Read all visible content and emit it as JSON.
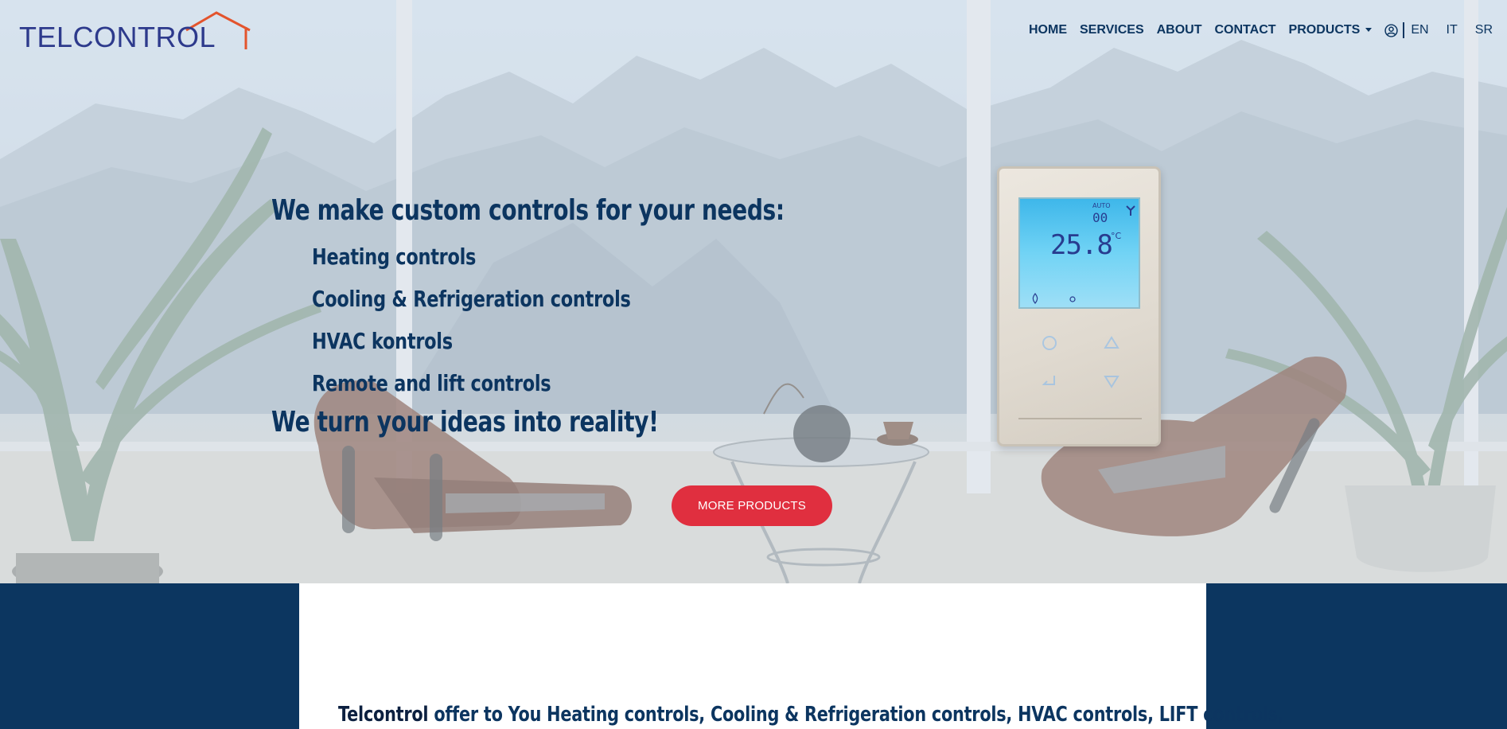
{
  "brand": {
    "logo_text": "TELCONTROL"
  },
  "nav": {
    "items": [
      "HOME",
      "SERVICES",
      "ABOUT",
      "CONTACT"
    ],
    "products": "PRODUCTS",
    "languages": [
      "EN",
      "IT",
      "SR"
    ]
  },
  "hero": {
    "headline": "We make custom controls for your needs:",
    "features": [
      "Heating controls",
      "Cooling & Refrigeration controls",
      "HVAC kontrols",
      "Remote and lift controls"
    ],
    "tagline": "We turn your ideas into reality!",
    "cta_label": "MORE PRODUCTS"
  },
  "thermostat": {
    "auto": "AUTO",
    "time": "00",
    "temperature": "25.8",
    "unit": "°C"
  },
  "intro": {
    "brand": "Telcontrol",
    "text": " offer to You Heating controls, Cooling & Refrigeration controls, HVAC controls, LIFT controls,"
  },
  "colors": {
    "navy": "#0c3560",
    "cta_red": "#e02f3f",
    "logo_blue": "#2d3a8c",
    "logo_roof": "#e3542d"
  }
}
